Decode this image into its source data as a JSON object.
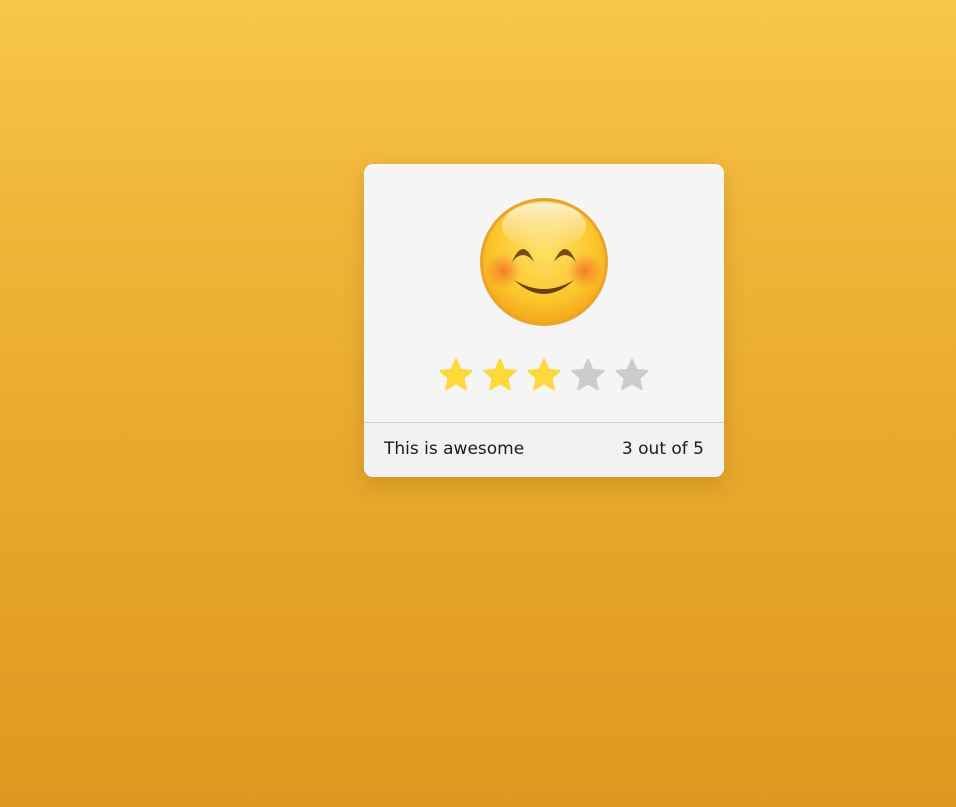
{
  "rating_card": {
    "face_icon": "smiling-face-with-smiling-eyes-icon",
    "stars": {
      "total": 5,
      "selected": 3,
      "filled_color": "#ffd93b",
      "empty_color": "#cccccc"
    },
    "footer": {
      "label": "This is awesome",
      "count_text": "3 out of 5"
    }
  },
  "colors": {
    "background_top": "#f7c74a",
    "background_bottom": "#df981f",
    "card_background": "#f5f5f5"
  }
}
